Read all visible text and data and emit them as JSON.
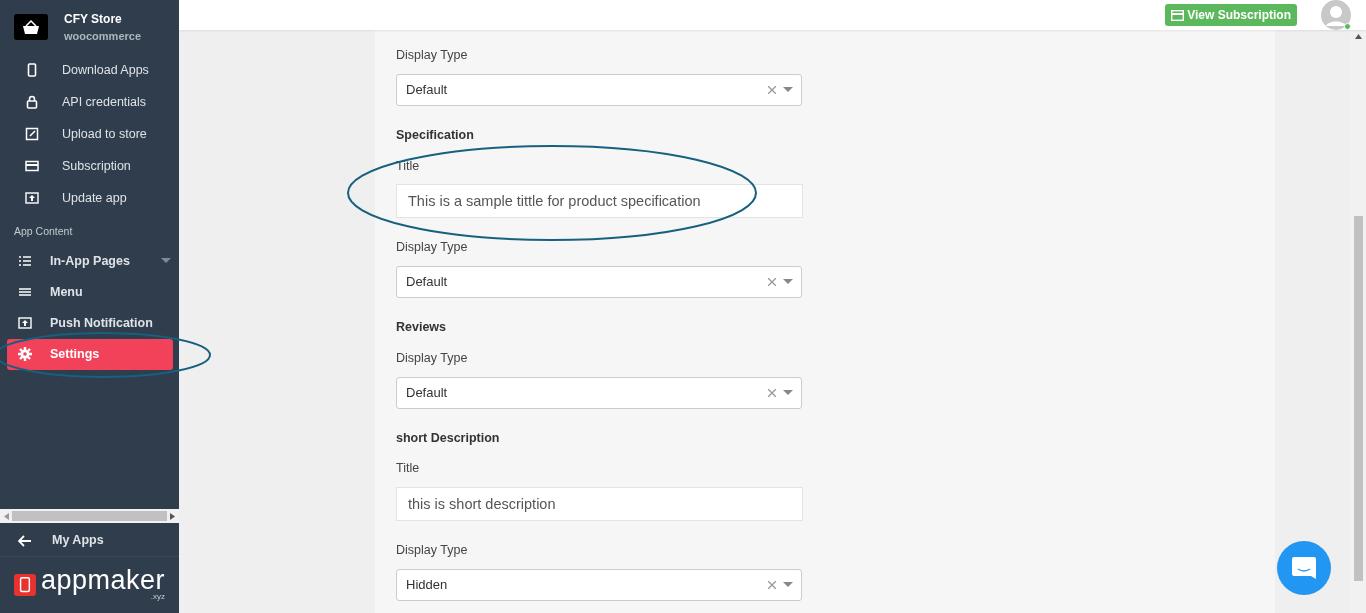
{
  "sidebar": {
    "store_name": "CFY Store",
    "platform": "woocommerce",
    "items": [
      {
        "kind": "item",
        "label": "Download Apps",
        "selected": false,
        "circled": false
      },
      {
        "kind": "item",
        "label": "API credentials",
        "selected": false,
        "circled": false
      },
      {
        "kind": "item",
        "label": "Upload to store",
        "selected": false,
        "circled": false
      },
      {
        "kind": "item",
        "label": "Subscription",
        "selected": false,
        "circled": false
      },
      {
        "kind": "item",
        "label": "Update app",
        "selected": false,
        "circled": false
      },
      {
        "kind": "section",
        "label": "App Content"
      },
      {
        "kind": "main",
        "label": "In-App Pages",
        "selected": false,
        "dropdown": true,
        "circled": false
      },
      {
        "kind": "main",
        "label": "Menu",
        "selected": false,
        "dropdown": false,
        "circled": false
      },
      {
        "kind": "main",
        "label": "Push Notification",
        "selected": false,
        "dropdown": false,
        "circled": false
      },
      {
        "kind": "main",
        "label": "Settings",
        "selected": true,
        "dropdown": false,
        "circled": true
      }
    ],
    "footer_link": "My Apps",
    "logo": {
      "name": "appmaker",
      "suffix": ".xyz"
    }
  },
  "header": {
    "button": "View Subscription",
    "avatar_online": true
  },
  "form": [
    {
      "kind": "select",
      "label": "Display Type",
      "value": "Default"
    },
    {
      "kind": "heading",
      "label": "Specification"
    },
    {
      "kind": "input",
      "label": "Title",
      "value": "This is a sample tittle for product specification",
      "circled": true
    },
    {
      "kind": "select",
      "label": "Display Type",
      "value": "Default"
    },
    {
      "kind": "heading",
      "label": "Reviews"
    },
    {
      "kind": "select",
      "label": "Display Type",
      "value": "Default"
    },
    {
      "kind": "heading",
      "label": "short Description"
    },
    {
      "kind": "input",
      "label": "Title",
      "value": "this is short description",
      "circled": false
    },
    {
      "kind": "select",
      "label": "Display Type",
      "value": "Hidden"
    }
  ]
}
